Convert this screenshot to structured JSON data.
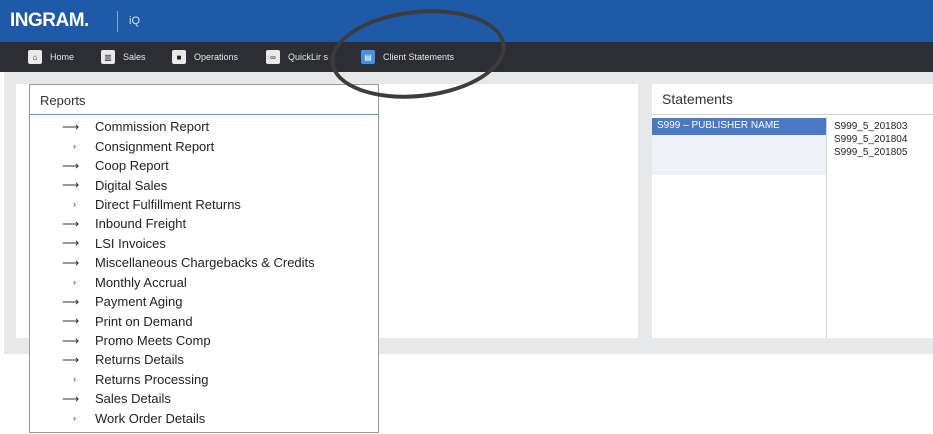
{
  "header": {
    "logo": "INGRAM.",
    "app_name": "iQ"
  },
  "nav": {
    "items": [
      {
        "label": "Home",
        "icon": "home-icon"
      },
      {
        "label": "Sales",
        "icon": "chart-icon"
      },
      {
        "label": "Operations",
        "icon": "truck-icon"
      },
      {
        "label": "QuickLir  s",
        "icon": "link-icon"
      },
      {
        "label": "Client Statements",
        "icon": "document-icon"
      }
    ]
  },
  "reports": {
    "title": "Reports",
    "items": [
      {
        "label": "Commission Report",
        "icon": "arrow-right-icon"
      },
      {
        "label": "Consignment Report",
        "icon": "chevron-right-icon"
      },
      {
        "label": "Coop Report",
        "icon": "arrow-right-icon"
      },
      {
        "label": "Digital Sales",
        "icon": "arrow-right-icon"
      },
      {
        "label": "Direct Fulfillment Returns",
        "icon": "chevron-right-icon"
      },
      {
        "label": "Inbound Freight",
        "icon": "arrow-right-icon"
      },
      {
        "label": "LSI Invoices",
        "icon": "arrow-right-icon"
      },
      {
        "label": "Miscellaneous Chargebacks & Credits",
        "icon": "arrow-right-icon"
      },
      {
        "label": "Monthly Accrual",
        "icon": "chevron-right-icon"
      },
      {
        "label": "Payment Aging",
        "icon": "arrow-right-icon"
      },
      {
        "label": "Print on Demand",
        "icon": "arrow-right-icon"
      },
      {
        "label": "Promo Meets Comp",
        "icon": "arrow-right-icon"
      },
      {
        "label": "Returns Details",
        "icon": "arrow-right-icon"
      },
      {
        "label": "Returns Processing",
        "icon": "chevron-right-icon"
      },
      {
        "label": "Sales Details",
        "icon": "arrow-right-icon"
      },
      {
        "label": "Work Order Details",
        "icon": "chevron-right-icon"
      }
    ]
  },
  "statements": {
    "title": "Statements",
    "publisher": "S999 – PUBLISHER NAME",
    "files": [
      "S999_5_201803",
      "S999_5_201804",
      "S999_5_201805"
    ]
  },
  "colors": {
    "topbar": "#1f5aa8",
    "navbar": "#2c2e33",
    "accent": "#4a90e2",
    "selected": "#4a78c2"
  }
}
